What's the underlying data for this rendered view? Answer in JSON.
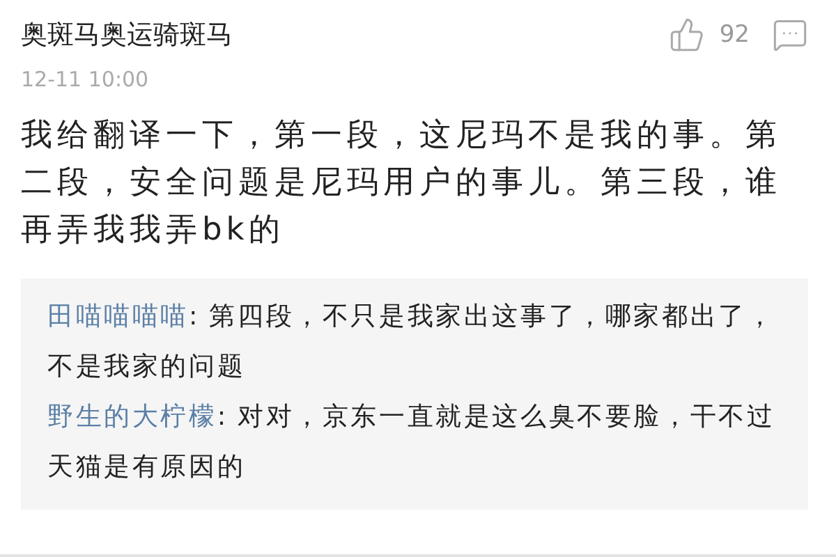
{
  "comment": {
    "author": "奥斑马奥运骑斑马",
    "likes": "92",
    "time": "12-11 10:00",
    "text": "我给翻译一下，第一段，这尼玛不是我的事。第二段，安全问题是尼玛用户的事儿。第三段，谁再弄我我弄bk的"
  },
  "replies": [
    {
      "author": "田喵喵喵喵",
      "text": ": 第四段，不只是我家出这事了，哪家都出了，不是我家的问题"
    },
    {
      "author": "野生的大柠檬",
      "text": ": 对对，京东一直就是这么臭不要脸，干不过天猫是有原因的"
    }
  ]
}
